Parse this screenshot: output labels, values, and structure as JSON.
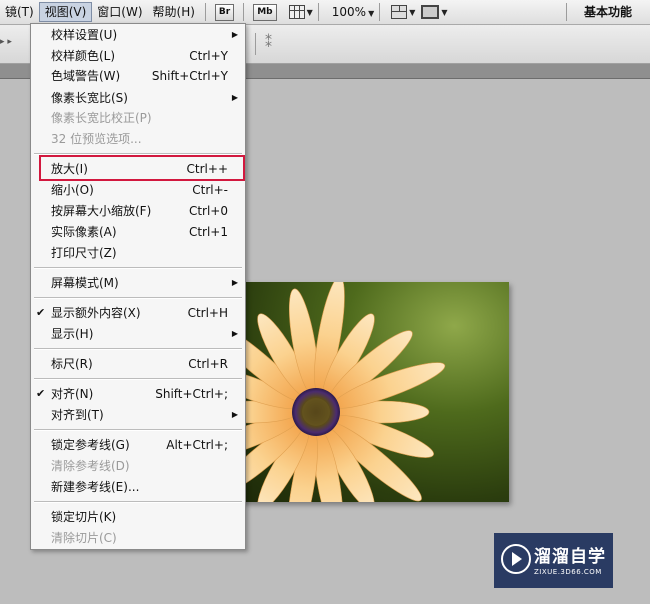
{
  "menubar": {
    "items": [
      "镜(T)",
      "视图(V)",
      "窗口(W)",
      "帮助(H)"
    ],
    "bridge_chip": "Br",
    "minibridge_chip": "Mb",
    "zoom": "100%",
    "workspace": "基本功能"
  },
  "options_bar": {
    "fragment": "▸ ▸",
    "symbol": "⁑"
  },
  "view_menu": {
    "items": [
      {
        "label": "校样设置(U)",
        "shortcut": "",
        "submenu": true,
        "disabled": false,
        "checked": false
      },
      {
        "label": "校样颜色(L)",
        "shortcut": "Ctrl+Y",
        "submenu": false,
        "disabled": false,
        "checked": false
      },
      {
        "label": "色域警告(W)",
        "shortcut": "Shift+Ctrl+Y",
        "submenu": false,
        "disabled": false,
        "checked": false
      },
      {
        "label": "像素长宽比(S)",
        "shortcut": "",
        "submenu": true,
        "disabled": false,
        "checked": false
      },
      {
        "label": "像素长宽比校正(P)",
        "shortcut": "",
        "submenu": false,
        "disabled": true,
        "checked": false
      },
      {
        "label": "32 位预览选项...",
        "shortcut": "",
        "submenu": false,
        "disabled": true,
        "checked": false
      },
      {
        "label": "放大(I)",
        "shortcut": "Ctrl++",
        "submenu": false,
        "disabled": false,
        "checked": false
      },
      {
        "label": "缩小(O)",
        "shortcut": "Ctrl+-",
        "submenu": false,
        "disabled": false,
        "checked": false
      },
      {
        "label": "按屏幕大小缩放(F)",
        "shortcut": "Ctrl+0",
        "submenu": false,
        "disabled": false,
        "checked": false
      },
      {
        "label": "实际像素(A)",
        "shortcut": "Ctrl+1",
        "submenu": false,
        "disabled": false,
        "checked": false
      },
      {
        "label": "打印尺寸(Z)",
        "shortcut": "",
        "submenu": false,
        "disabled": false,
        "checked": false
      },
      {
        "label": "屏幕模式(M)",
        "shortcut": "",
        "submenu": true,
        "disabled": false,
        "checked": false
      },
      {
        "label": "显示额外内容(X)",
        "shortcut": "Ctrl+H",
        "submenu": false,
        "disabled": false,
        "checked": true
      },
      {
        "label": "显示(H)",
        "shortcut": "",
        "submenu": true,
        "disabled": false,
        "checked": false
      },
      {
        "label": "标尺(R)",
        "shortcut": "Ctrl+R",
        "submenu": false,
        "disabled": false,
        "checked": false
      },
      {
        "label": "对齐(N)",
        "shortcut": "Shift+Ctrl+;",
        "submenu": false,
        "disabled": false,
        "checked": true
      },
      {
        "label": "对齐到(T)",
        "shortcut": "",
        "submenu": true,
        "disabled": false,
        "checked": false
      },
      {
        "label": "锁定参考线(G)",
        "shortcut": "Alt+Ctrl+;",
        "submenu": false,
        "disabled": false,
        "checked": false
      },
      {
        "label": "清除参考线(D)",
        "shortcut": "",
        "submenu": false,
        "disabled": true,
        "checked": false
      },
      {
        "label": "新建参考线(E)...",
        "shortcut": "",
        "submenu": false,
        "disabled": false,
        "checked": false
      },
      {
        "label": "锁定切片(K)",
        "shortcut": "",
        "submenu": false,
        "disabled": false,
        "checked": false
      },
      {
        "label": "清除切片(C)",
        "shortcut": "",
        "submenu": false,
        "disabled": true,
        "checked": false
      }
    ],
    "check_glyph": "✔",
    "submenu_glyph": "▶"
  },
  "logo": {
    "title": "溜溜自学",
    "url": "ZIXUE.3D66.COM"
  },
  "highlight_color": "#d2183e"
}
